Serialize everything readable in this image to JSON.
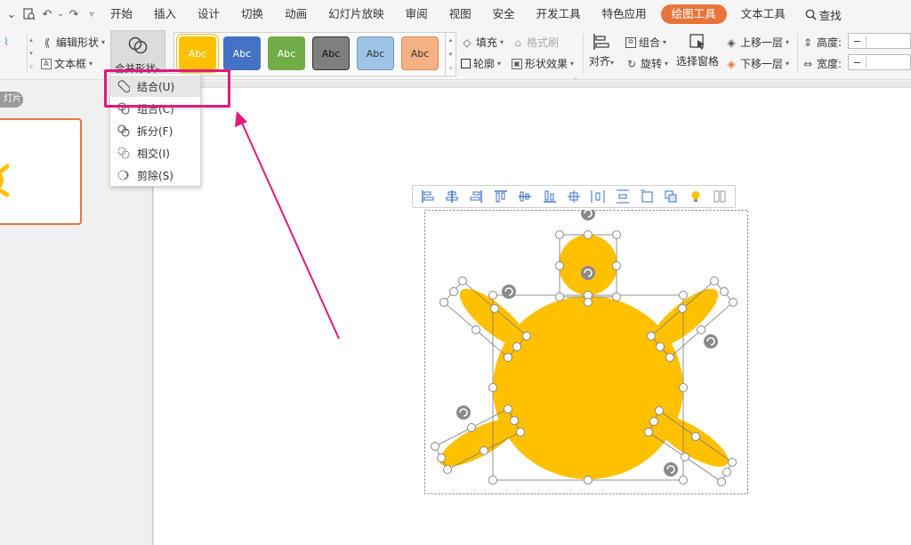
{
  "menu": {
    "tabs": [
      "开始",
      "插入",
      "设计",
      "切换",
      "动画",
      "幻灯片放映",
      "审阅",
      "视图",
      "安全",
      "开发工具",
      "特色应用",
      "绘图工具",
      "文本工具"
    ],
    "active_tab": "绘图工具",
    "search_label": "查找"
  },
  "ribbon": {
    "edit_shape": "编辑形状",
    "text_box": "文本框",
    "merge_shapes": "合并形状",
    "style_label": "Abc",
    "fill": "填充",
    "format_painter": "格式刷",
    "outline": "轮廓",
    "shape_effects": "形状效果",
    "align": "对齐",
    "group": "组合",
    "rotate": "旋转",
    "selection_pane": "选择窗格",
    "bring_forward": "上移一层",
    "send_backward": "下移一层",
    "height_label": "高度:",
    "width_label": "宽度:",
    "height_value": "−",
    "width_value": "−"
  },
  "sidepanel": {
    "slide_tag": "灯片"
  },
  "dropdown": {
    "items": [
      "结合(U)",
      "组合(C)",
      "拆分(F)",
      "相交(I)",
      "剪除(S)"
    ]
  },
  "colors": {
    "accent": "#e8743b",
    "highlight": "#e0197b",
    "shape_fill": "#ffc000",
    "style_swatches": [
      "#ffc000",
      "#4472c4",
      "#70ad47",
      "#7f7f7f",
      "#9dc3e6",
      "#f4b183"
    ]
  },
  "icons": [
    "redo-icon",
    "undo-icon",
    "print-preview-icon",
    "search-icon",
    "merge-shapes-icon",
    "rotate-handle-icon",
    "lightbulb-icon"
  ]
}
